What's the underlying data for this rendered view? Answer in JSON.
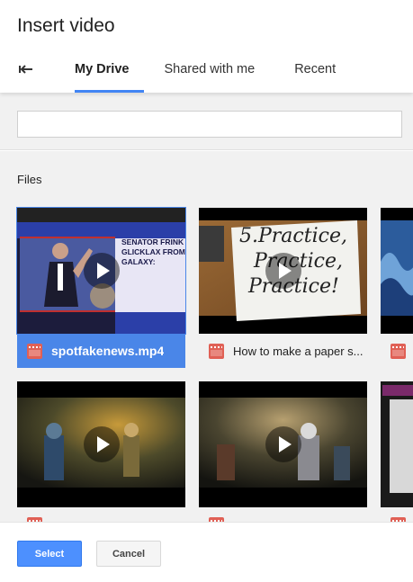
{
  "dialog": {
    "title": "Insert video"
  },
  "tabs": [
    {
      "label": "My Drive",
      "active": true
    },
    {
      "label": "Shared with me",
      "active": false
    },
    {
      "label": "Recent",
      "active": false
    }
  ],
  "search": {
    "value": "",
    "placeholder": ""
  },
  "files_section": {
    "label": "Files"
  },
  "files": [
    {
      "name": "spotfakenews.mp4",
      "selected": true,
      "icon": "video-file-icon"
    },
    {
      "name": "How to make a paper s...",
      "selected": false,
      "icon": "video-file-icon"
    },
    {
      "name": "",
      "selected": false,
      "icon": "video-file-icon"
    },
    {
      "name": "",
      "selected": false,
      "icon": "video-file-icon"
    },
    {
      "name": "",
      "selected": false,
      "icon": "video-file-icon"
    },
    {
      "name": "",
      "selected": false,
      "icon": "video-file-icon"
    }
  ],
  "thumbnail_texts": {
    "news_headline": "SENATOR FRINK GLICKLAX FROM GALAXY:",
    "paper": [
      "5.Practice,",
      "Practice,",
      "Practice!"
    ]
  },
  "footer": {
    "select_label": "Select",
    "cancel_label": "Cancel"
  },
  "colors": {
    "accent": "#4285f4",
    "selection": "#4a86e8",
    "video_icon": "#e06055"
  }
}
